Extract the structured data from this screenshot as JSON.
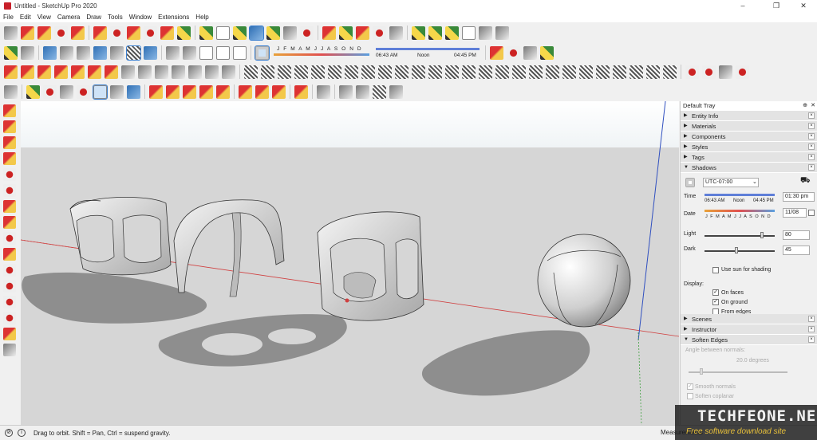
{
  "window": {
    "title": "Untitled - SketchUp Pro 2020",
    "minimize": "–",
    "maximize": "❐",
    "close": "✕"
  },
  "menu": [
    "File",
    "Edit",
    "View",
    "Camera",
    "Draw",
    "Tools",
    "Window",
    "Extensions",
    "Help"
  ],
  "shadow_toolbar": {
    "months": "J F M A M J J A S O N D",
    "time_start": "06:43 AM",
    "time_noon": "Noon",
    "time_end": "04:45 PM"
  },
  "tray": {
    "title": "Default Tray",
    "pin": "⊕",
    "close": "✕",
    "panels_top": [
      "Entity Info",
      "Materials",
      "Components",
      "Styles",
      "Tags"
    ],
    "shadows": {
      "header": "Shadows",
      "timezone": "UTC-07:00",
      "time_label": "Time",
      "time_start": "06:43 AM",
      "time_noon": "Noon",
      "time_end": "04:45 PM",
      "time_value": "01:30 pm",
      "date_label": "Date",
      "date_months": "J F M A M J J A S O N D",
      "date_value": "11/08",
      "light_label": "Light",
      "light_value": "80",
      "light_level": 0.8,
      "dark_label": "Dark",
      "dark_value": "45",
      "dark_level": 0.45,
      "use_sun": "Use sun for shading",
      "display_label": "Display:",
      "on_faces": "On faces",
      "on_ground": "On ground",
      "from_edges": "From edges"
    },
    "panels_bottom": [
      "Scenes",
      "Instructor"
    ],
    "soften": {
      "header": "Soften Edges",
      "angle_label": "Angle between normals:",
      "angle_value": "20.0  degrees",
      "smooth_normals": "Smooth normals",
      "soften_coplanar": "Soften coplanar"
    }
  },
  "status": {
    "message": "Drag to orbit. Shift = Pan, Ctrl = suspend gravity.",
    "measurements": "Measurements"
  },
  "watermark": {
    "line1": "TECHFEONE.NET",
    "line2": "Free software download site"
  },
  "colors": {
    "axis_red": "#d04040",
    "axis_blue": "#3050c0",
    "axis_green": "#40a040",
    "sky": "#ffffff",
    "ground": "#d6d6d6",
    "shadow": "#8a8a8a"
  }
}
